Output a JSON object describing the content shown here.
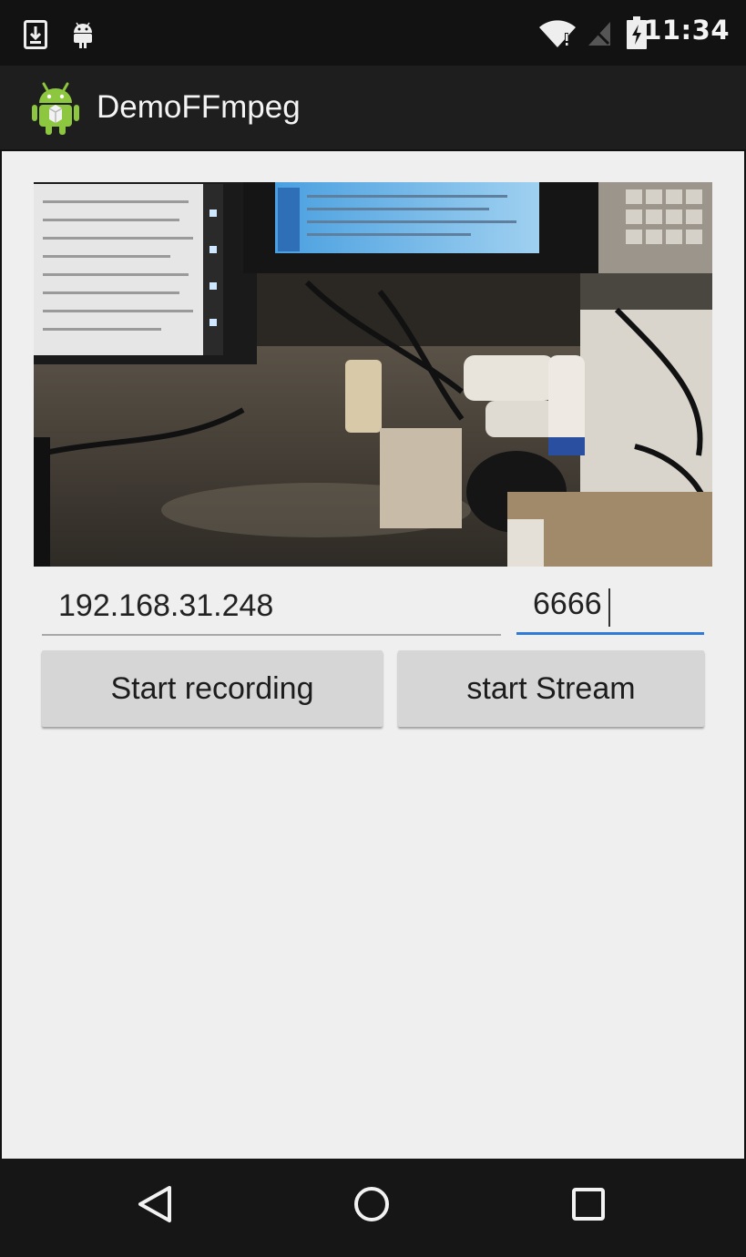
{
  "status_bar": {
    "time": "11:34",
    "icons": [
      "download-icon",
      "android-debug-icon",
      "wifi-icon",
      "no-signal-icon",
      "battery-charging-icon"
    ]
  },
  "action_bar": {
    "title": "DemoFFmpeg",
    "icon": "android-app-icon"
  },
  "main": {
    "camera_preview": "camera-preview",
    "ip_field": {
      "value": "192.168.31.248"
    },
    "port_field": {
      "value": "6666"
    },
    "start_recording_label": "Start recording",
    "start_stream_label": "start Stream"
  },
  "nav_bar": {
    "icons": [
      "back-icon",
      "home-icon",
      "recents-icon"
    ]
  },
  "colors": {
    "accent": "#2f7ad8",
    "status_bar": "#121212",
    "action_bar": "#1e1e1e",
    "content_bg": "#efefef",
    "button_bg": "#d6d6d6"
  }
}
